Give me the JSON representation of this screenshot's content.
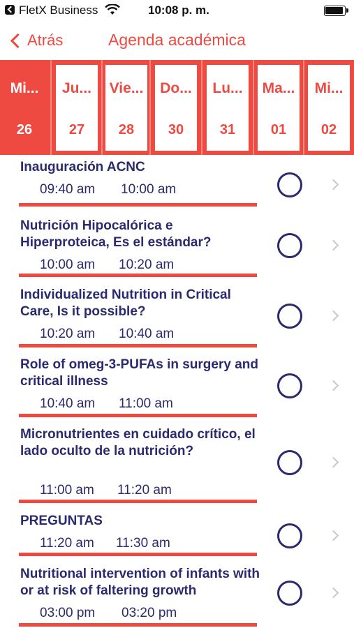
{
  "status_bar": {
    "app_name": "FletX Business",
    "time": "10:08 p. m."
  },
  "nav": {
    "back_label": "Atrás",
    "title": "Agenda académica"
  },
  "colors": {
    "accent": "#ee4a41",
    "text": "#2b2a6e",
    "chevron": "#c7c7cc"
  },
  "dates": [
    {
      "day": "Mi...",
      "num": "26",
      "active": true
    },
    {
      "day": "Ju...",
      "num": "27",
      "active": false
    },
    {
      "day": "Vie...",
      "num": "28",
      "active": false
    },
    {
      "day": "Do...",
      "num": "30",
      "active": false
    },
    {
      "day": "Lu...",
      "num": "31",
      "active": false
    },
    {
      "day": "Ma...",
      "num": "01",
      "active": false
    },
    {
      "day": "Mi...",
      "num": "02",
      "active": false
    }
  ],
  "items": [
    {
      "title": "Inauguración ACNC",
      "start": "09:40 am",
      "end": "10:00 am"
    },
    {
      "title": "Nutrición Hipocalórica e Hiperproteica, Es el estándar?",
      "start": "10:00 am",
      "end": "10:20 am"
    },
    {
      "title": "Individualized Nutrition in Critical Care, Is it possible?",
      "start": "10:20 am",
      "end": "10:40 am"
    },
    {
      "title": "Role of omeg-3-PUFAs in surgery and critical illness",
      "start": "10:40 am",
      "end": "11:00 am"
    },
    {
      "title": "Micronutrientes en cuidado crítico, el lado oculto de la nutrición?",
      "start": "11:00 am",
      "end": "11:20 am"
    },
    {
      "title": "PREGUNTAS",
      "start": "11:20 am",
      "end": "11:30 am"
    },
    {
      "title": "Nutritional intervention of infants with or at risk of faltering growth",
      "start": "03:00 pm",
      "end": "03:20 pm"
    }
  ]
}
